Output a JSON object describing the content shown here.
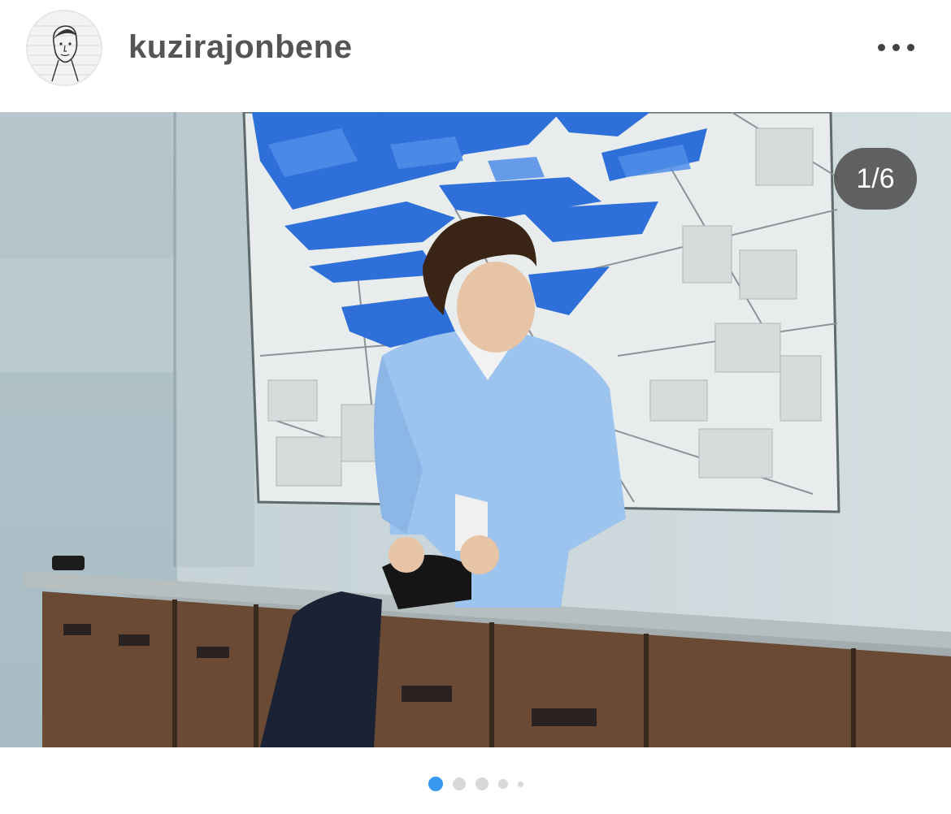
{
  "post": {
    "username": "kuzirajonbene",
    "counter": "1/6"
  },
  "carousel": {
    "active_index": 0,
    "total_slides": 6
  },
  "colors": {
    "accent": "#3897f0",
    "inactive_dot": "#d8d8d8",
    "username_text": "#555555"
  },
  "icons": {
    "more": "horizontal-ellipsis",
    "avatar": "sketch-portrait"
  }
}
